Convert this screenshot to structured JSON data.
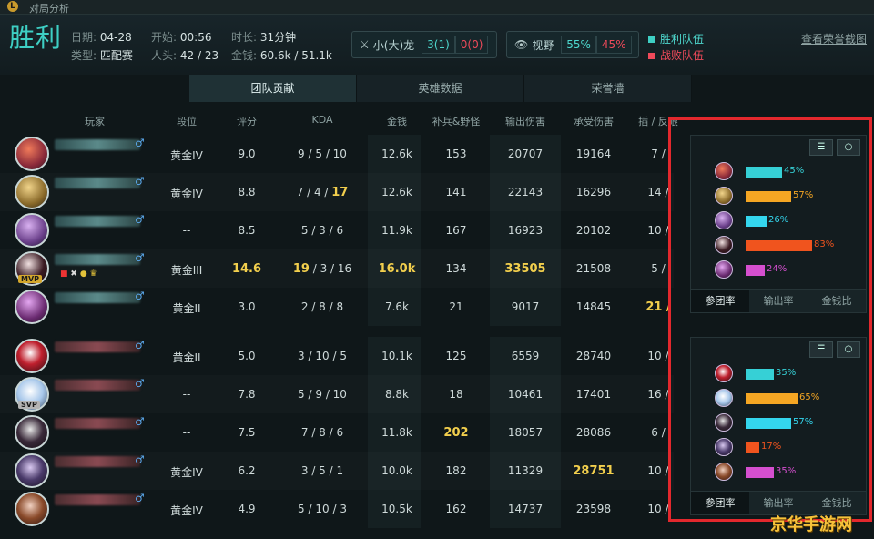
{
  "window": {
    "title": "对局分析"
  },
  "header": {
    "result": "胜利",
    "date_label": "日期:",
    "date": "04-28",
    "start_label": "开始:",
    "start": "00:56",
    "duration_label": "时长:",
    "duration": "31分钟",
    "type_label": "类型:",
    "type": "匹配赛",
    "kills_label": "人头:",
    "kills": "42 / 23",
    "gold_label": "金钱:",
    "gold": "60.6k / 51.1k",
    "dragon_label": "小(大)龙",
    "dragon_win": "3(1)",
    "dragon_lose": "0(0)",
    "vision_label": "视野",
    "vision_win": "55%",
    "vision_lose": "45%",
    "legend_win": "胜利队伍",
    "legend_lose": "战败队伍",
    "screenshot_link": "查看荣誉截图"
  },
  "tabs": [
    "团队贡献",
    "英雄数据",
    "荣誉墙"
  ],
  "columns": [
    "玩家",
    "段位",
    "评分",
    "KDA",
    "金钱",
    "补兵&野怪",
    "输出伤害",
    "承受伤害",
    "插 / 反眼"
  ],
  "win_team": [
    {
      "rank": "黄金IV",
      "score": "9.0",
      "k": "9",
      "d": "5",
      "a": "10",
      "gold": "12.6k",
      "cs": "153",
      "dmg": "20707",
      "taken": "19164",
      "wards": "7 /",
      "hl": []
    },
    {
      "rank": "黄金IV",
      "score": "8.8",
      "k": "7",
      "d": "4",
      "a": "17",
      "gold": "12.6k",
      "cs": "141",
      "dmg": "22143",
      "taken": "16296",
      "wards": "14 /",
      "hl": [
        "a"
      ]
    },
    {
      "rank": "--",
      "score": "8.5",
      "k": "5",
      "d": "3",
      "a": "6",
      "gold": "11.9k",
      "cs": "167",
      "dmg": "16923",
      "taken": "20102",
      "wards": "10 /",
      "hl": []
    },
    {
      "rank": "黄金III",
      "score": "14.6",
      "k": "19",
      "d": "3",
      "a": "16",
      "gold": "16.0k",
      "cs": "134",
      "dmg": "33505",
      "taken": "21508",
      "wards": "5 /",
      "hl": [
        "score",
        "k",
        "gold",
        "dmg"
      ]
    },
    {
      "rank": "黄金II",
      "score": "3.0",
      "k": "2",
      "d": "8",
      "a": "8",
      "gold": "7.6k",
      "cs": "21",
      "dmg": "9017",
      "taken": "14845",
      "wards": "21 /",
      "hl": [
        "wards"
      ]
    }
  ],
  "lose_team": [
    {
      "rank": "黄金II",
      "score": "5.0",
      "k": "3",
      "d": "10",
      "a": "5",
      "gold": "10.1k",
      "cs": "125",
      "dmg": "6559",
      "taken": "28740",
      "wards": "10 /",
      "hl": []
    },
    {
      "rank": "--",
      "score": "7.8",
      "k": "5",
      "d": "9",
      "a": "10",
      "gold": "8.8k",
      "cs": "18",
      "dmg": "10461",
      "taken": "17401",
      "wards": "16 /",
      "hl": []
    },
    {
      "rank": "--",
      "score": "7.5",
      "k": "7",
      "d": "8",
      "a": "6",
      "gold": "11.8k",
      "cs": "202",
      "dmg": "18057",
      "taken": "28086",
      "wards": "6 /",
      "hl": [
        "cs"
      ]
    },
    {
      "rank": "黄金IV",
      "score": "6.2",
      "k": "3",
      "d": "5",
      "a": "1",
      "gold": "10.0k",
      "cs": "182",
      "dmg": "11329",
      "taken": "28751",
      "wards": "10 /",
      "hl": [
        "taken"
      ]
    },
    {
      "rank": "黄金IV",
      "score": "4.9",
      "k": "5",
      "d": "10",
      "a": "3",
      "gold": "10.5k",
      "cs": "162",
      "dmg": "14737",
      "taken": "23598",
      "wards": "10 /",
      "hl": []
    }
  ],
  "badges": {
    "mvp": "MVP",
    "svp": "SVP"
  },
  "panel_tabs": [
    "参团率",
    "输出率",
    "金钱比"
  ],
  "panel_win": [
    {
      "pct": "45%",
      "value": 0.45,
      "color": "#36d0d6"
    },
    {
      "pct": "57%",
      "value": 0.57,
      "color": "#f5a623"
    },
    {
      "pct": "26%",
      "value": 0.26,
      "color": "#34d6ee"
    },
    {
      "pct": "83%",
      "value": 0.83,
      "color": "#f0541e"
    },
    {
      "pct": "24%",
      "value": 0.24,
      "color": "#d54fcf"
    }
  ],
  "panel_lose": [
    {
      "pct": "35%",
      "value": 0.35,
      "color": "#36d0d6"
    },
    {
      "pct": "65%",
      "value": 0.65,
      "color": "#f5a623"
    },
    {
      "pct": "57%",
      "value": 0.57,
      "color": "#34d6ee"
    },
    {
      "pct": "17%",
      "value": 0.17,
      "color": "#f0541e"
    },
    {
      "pct": "35%",
      "value": 0.35,
      "color": "#d54fcf"
    }
  ],
  "watermark": "京华手游网",
  "colors": {
    "win": "#3ecfc4",
    "lose": "#ef4a5a",
    "highlight": "#f2cf4d"
  }
}
